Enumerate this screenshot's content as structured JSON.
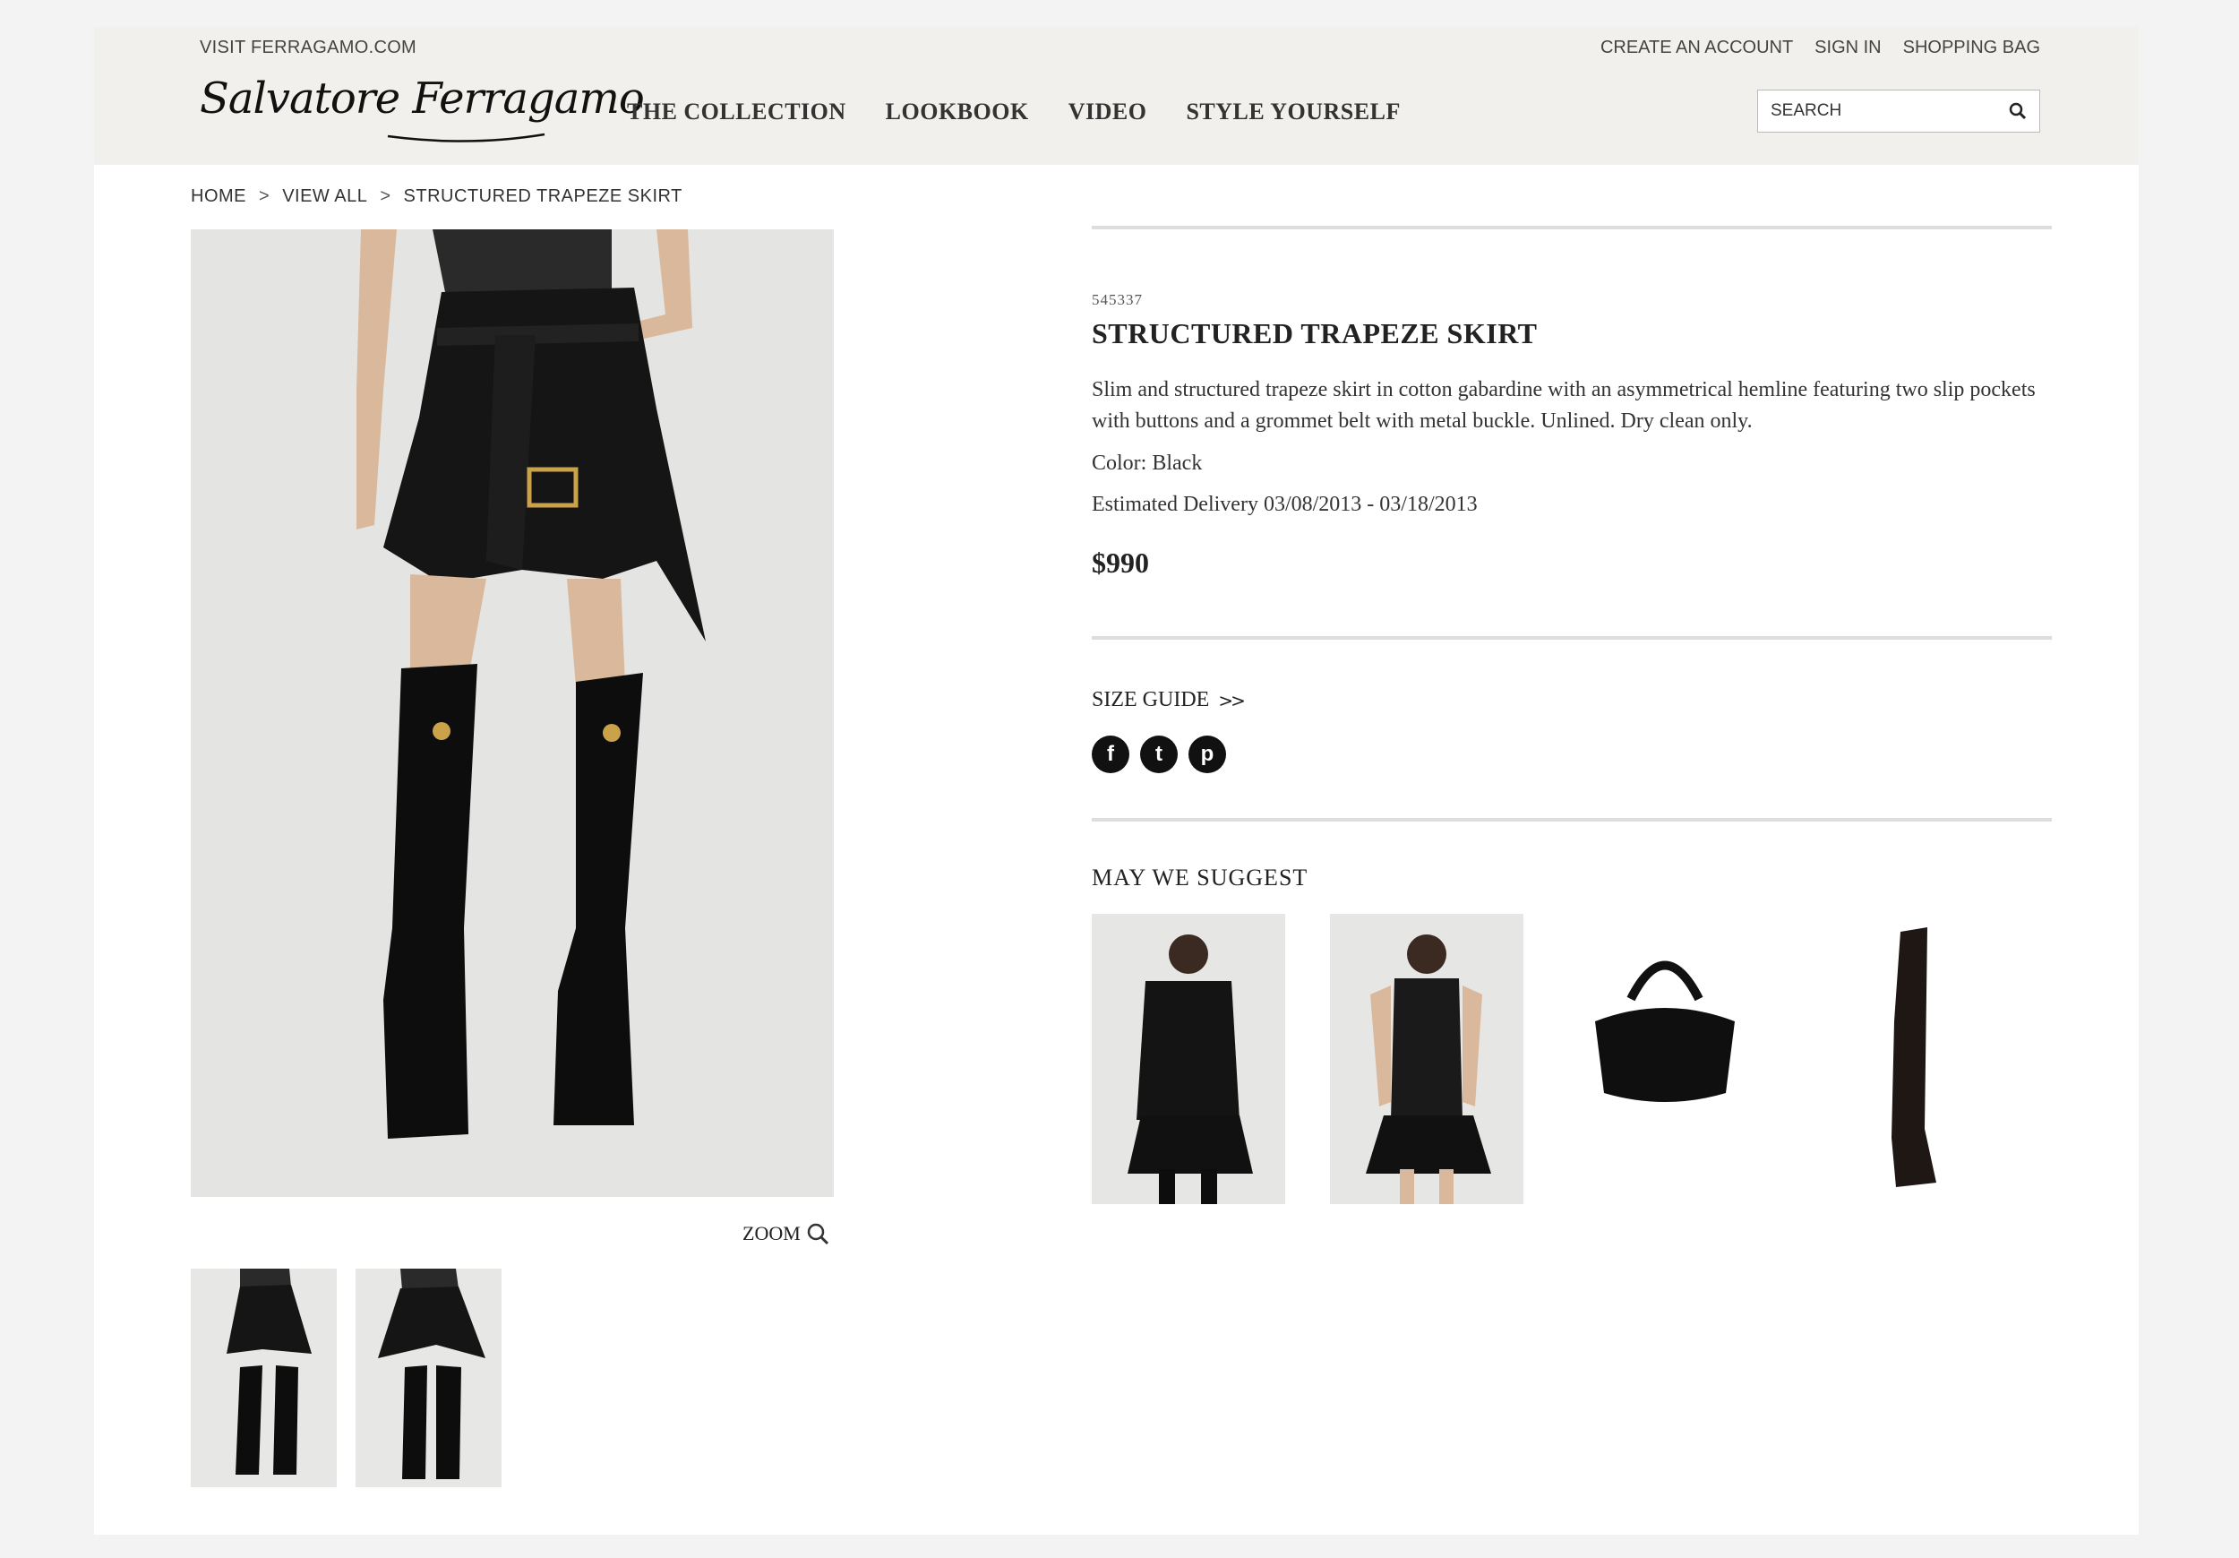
{
  "header": {
    "visit_link": "VISIT FERRAGAMO.COM",
    "account_links": [
      "CREATE AN ACCOUNT",
      "SIGN IN",
      "SHOPPING BAG"
    ],
    "logo_text": "Salvatore Ferragamo",
    "nav": [
      "THE COLLECTION",
      "LOOKBOOK",
      "VIDEO",
      "STYLE YOURSELF"
    ],
    "search_placeholder": "SEARCH"
  },
  "breadcrumb": {
    "items": [
      "HOME",
      "VIEW ALL",
      "STRUCTURED TRAPEZE SKIRT"
    ],
    "separator": ">"
  },
  "gallery": {
    "zoom_label": "ZOOM"
  },
  "product": {
    "sku": "545337",
    "title": "STRUCTURED TRAPEZE SKIRT",
    "description": "Slim and structured trapeze skirt in cotton gabardine with an asymmetrical hemline featuring two slip pockets with buttons and a grommet belt with metal buckle. Unlined. Dry clean only.",
    "color": "Color: Black",
    "delivery": "Estimated Delivery 03/08/2013 - 03/18/2013",
    "price": "$990",
    "size_guide": "SIZE GUIDE",
    "size_guide_arrow": ">>"
  },
  "social": {
    "icons": [
      "facebook-icon",
      "twitter-icon",
      "pinterest-icon"
    ],
    "glyphs": [
      "f",
      "t",
      "p"
    ]
  },
  "suggest": {
    "heading": "MAY WE SUGGEST"
  },
  "colors": {
    "topbar_bg": "#f2f0ec",
    "divider": "#dddddd",
    "text": "#222222"
  }
}
